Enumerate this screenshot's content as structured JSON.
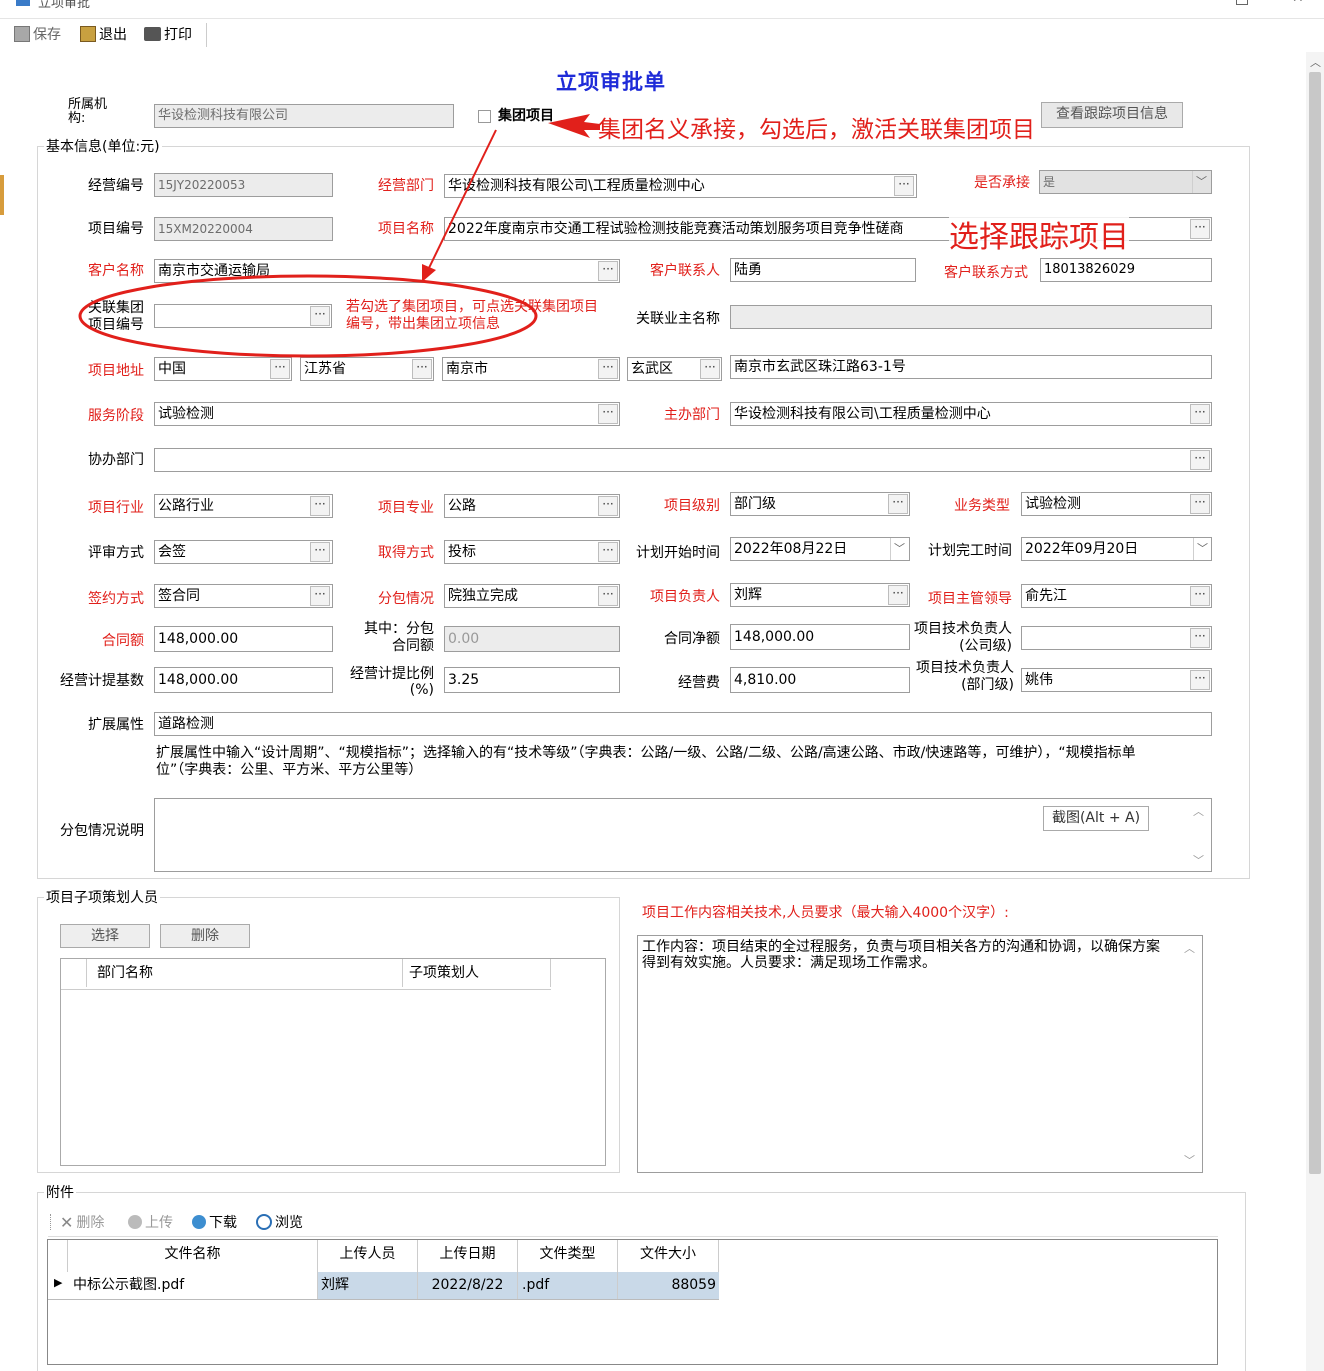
{
  "window": {
    "title": "立项审批"
  },
  "toolbar": {
    "save": "保存",
    "exit": "退出",
    "print": "打印"
  },
  "form": {
    "title": "立项审批单",
    "org_label": "所属机构:",
    "org_value": "华设检测科技有限公司",
    "group_project_label": "集团项目",
    "view_tracking_button": "查看跟踪项目信息",
    "basic_info_title": "基本信息(单位:元)",
    "fields": {
      "biz_no": {
        "label": "经营编号",
        "value": "15JY20220053"
      },
      "biz_dept": {
        "label": "经营部门",
        "value": "华设检测科技有限公司\\工程质量检测中心"
      },
      "undertake": {
        "label": "是否承接",
        "value": "是"
      },
      "proj_no": {
        "label": "项目编号",
        "value": "15XM20220004"
      },
      "proj_name": {
        "label": "项目名称",
        "value": "2022年度南京市交通工程试验检测技能竞赛活动策划服务项目竞争性磋商"
      },
      "client_name": {
        "label": "客户名称",
        "value": "南京市交通运输局"
      },
      "client_contact": {
        "label": "客户联系人",
        "value": "陆勇"
      },
      "client_phone": {
        "label": "客户联系方式",
        "value": "18013826029"
      },
      "group_proj_no": {
        "label": "关联集团项目编号",
        "value": ""
      },
      "owner_name": {
        "label": "关联业主名称",
        "value": ""
      },
      "address": {
        "label": "项目地址",
        "country": "中国",
        "province": "江苏省",
        "city": "南京市",
        "district": "玄武区",
        "detail": "南京市玄武区珠江路63-1号"
      },
      "service_stage": {
        "label": "服务阶段",
        "value": "试验检测"
      },
      "host_dept": {
        "label": "主办部门",
        "value": "华设检测科技有限公司\\工程质量检测中心"
      },
      "assist_dept": {
        "label": "协办部门",
        "value": ""
      },
      "industry": {
        "label": "项目行业",
        "value": "公路行业"
      },
      "specialty": {
        "label": "项目专业",
        "value": "公路"
      },
      "level": {
        "label": "项目级别",
        "value": "部门级"
      },
      "biz_type": {
        "label": "业务类型",
        "value": "试验检测"
      },
      "review": {
        "label": "评审方式",
        "value": "会签"
      },
      "obtain": {
        "label": "取得方式",
        "value": "投标"
      },
      "plan_start": {
        "label": "计划开始时间",
        "value": "2022年08月22日"
      },
      "plan_end": {
        "label": "计划完工时间",
        "value": "2022年09月20日"
      },
      "sign": {
        "label": "签约方式",
        "value": "签合同"
      },
      "subcontract": {
        "label": "分包情况",
        "value": "院独立完成"
      },
      "pm": {
        "label": "项目负责人",
        "value": "刘辉"
      },
      "leader": {
        "label": "项目主管领导",
        "value": "俞先江"
      },
      "contract_amt": {
        "label": "合同额",
        "value": "148,000.00"
      },
      "sub_amt": {
        "label": "其中：分包合同额",
        "value": "0.00"
      },
      "net_amt": {
        "label": "合同净额",
        "value": "148,000.00"
      },
      "tech_company": {
        "label": "项目技术负责人(公司级)",
        "value": ""
      },
      "base_amt": {
        "label": "经营计提基数",
        "value": "148,000.00"
      },
      "ratio": {
        "label": "经营计提比例(%)",
        "value": "3.25"
      },
      "fee": {
        "label": "经营费",
        "value": "4,810.00"
      },
      "tech_dept": {
        "label": "项目技术负责人(部门级)",
        "value": "姚伟"
      },
      "ext": {
        "label": "扩展属性",
        "value": "道路检测"
      },
      "ext_hint": "扩展属性中输入“设计周期”、“规模指标”；选择输入的有“技术等级”（字典表：公路/一级、公路/二级、公路/高速公路、市政/快速路等，可维护），“规模指标单位”（字典表：公里、平方米、平方公里等）",
      "sub_desc": {
        "label": "分包情况说明",
        "value": ""
      },
      "screenshot_btn": "截图(Alt + A)"
    },
    "planners": {
      "title": "项目子项策划人员",
      "select": "选择",
      "delete": "删除",
      "col_dept": "部门名称",
      "col_planner": "子项策划人"
    },
    "work": {
      "label": "项目工作内容相关技术,人员要求（最大输入4000个汉字）:",
      "content": "工作内容：项目结束的全过程服务，负责与项目相关各方的沟通和协调，以确保方案得到有效实施。人员要求：满足现场工作需求。"
    },
    "attach": {
      "title": "附件",
      "delete": "删除",
      "upload": "上传",
      "download": "下载",
      "browse": "浏览",
      "columns": [
        "文件名称",
        "上传人员",
        "上传日期",
        "文件类型",
        "文件大小"
      ],
      "rows": [
        {
          "name": "中标公示截图.pdf",
          "user": "刘辉",
          "date": "2022/8/22",
          "type": ".pdf",
          "size": "88059"
        }
      ]
    }
  },
  "annotations": {
    "a1": "集团名义承接，勾选后，激活关联集团项目",
    "a2": "选择跟踪项目",
    "a3": "若勾选了集团项目，可点选关联集团项目编号，带出集团立项信息"
  },
  "colors": {
    "required_label": "#e1201b",
    "title_blue": "#1e2bd8",
    "annotation": "#e1201b"
  }
}
